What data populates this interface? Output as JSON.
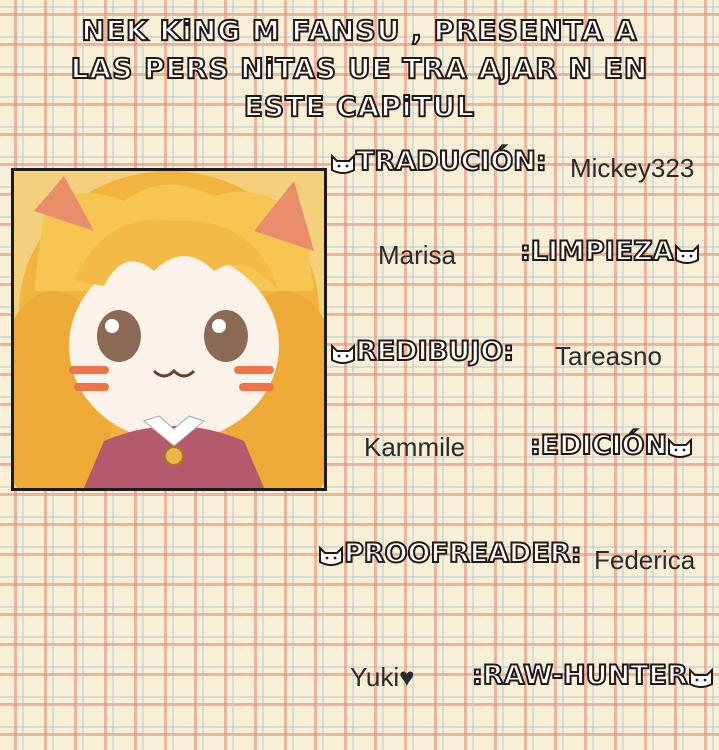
{
  "header": {
    "line1": "NEK  KiNG  M FANSU  , PRESENTA A",
    "line2": "LAS PERS NiTAS  UE TRA AJAR N EN",
    "line3": "ESTE CAPiTUL "
  },
  "credits": [
    {
      "role": "TRADUCIÓN:",
      "name": "Mickey323"
    },
    {
      "role": ":LIMPIEZA",
      "name": "Marisa"
    },
    {
      "role": "REDIBUJO:",
      "name": "Tareasno"
    },
    {
      "role": ":EDICIÓN",
      "name": "Kammile"
    },
    {
      "role": "PROOFREADER:",
      "name": "Federica"
    },
    {
      "role": ":RAW-HUNTER",
      "name": "Yuki♥"
    }
  ],
  "colors": {
    "plaid_base": "#f7efd6",
    "plaid_red": "#e88470",
    "plaid_blue": "#aac8d7",
    "text_outline": "#231814"
  }
}
